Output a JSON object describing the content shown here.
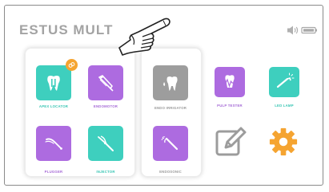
{
  "header": {
    "title": "ESTUS MULT",
    "status_icons": [
      "speaker-icon",
      "battery-icon"
    ]
  },
  "colors": {
    "teal": "#3ecfbe",
    "purple": "#ad6be0",
    "gray": "#9d9d9d",
    "orange": "#f5a431",
    "label_purple": "#a56ad6",
    "label_teal": "#37c5b3",
    "label_gray": "#9a9a9a",
    "title_gray": "#a3a3a3"
  },
  "modes": {
    "apex_locator": "APEX LOCATOR",
    "endomotor": "ENDOMOTOR",
    "plugger": "PLUGGER",
    "injector": "INJECTOR",
    "endo_irrigator": "ENDO IRRIGATOR",
    "endosonic": "ENDOSONIC",
    "pulp_tester": "PULP TESTER",
    "led_lamp": "LED LAMP"
  },
  "icons": {
    "apex_locator": "tooth-icon",
    "endomotor": "handpiece-icon",
    "plugger": "plugger-instrument-icon",
    "injector": "injector-gun-icon",
    "endo_irrigator": "tooth-drop-icon",
    "endosonic": "scaler-tip-icon",
    "pulp_tester": "heartbeat-icon",
    "led_lamp": "curing-light-icon",
    "edit": "edit-icon",
    "settings": "gear-icon",
    "badge": "link-icon",
    "pointer": "pointing-hand-icon"
  }
}
